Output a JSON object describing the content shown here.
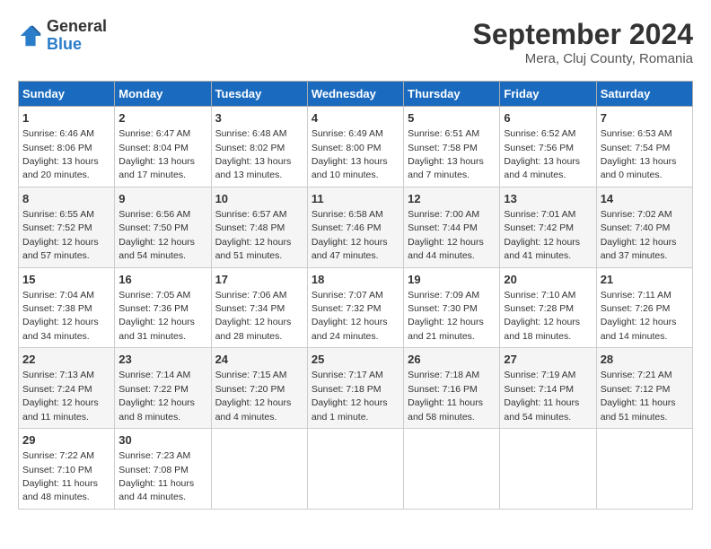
{
  "logo": {
    "line1": "General",
    "line2": "Blue"
  },
  "title": "September 2024",
  "subtitle": "Mera, Cluj County, Romania",
  "headers": [
    "Sunday",
    "Monday",
    "Tuesday",
    "Wednesday",
    "Thursday",
    "Friday",
    "Saturday"
  ],
  "weeks": [
    [
      {
        "day": "1",
        "info": "Sunrise: 6:46 AM\nSunset: 8:06 PM\nDaylight: 13 hours and 20 minutes."
      },
      {
        "day": "2",
        "info": "Sunrise: 6:47 AM\nSunset: 8:04 PM\nDaylight: 13 hours and 17 minutes."
      },
      {
        "day": "3",
        "info": "Sunrise: 6:48 AM\nSunset: 8:02 PM\nDaylight: 13 hours and 13 minutes."
      },
      {
        "day": "4",
        "info": "Sunrise: 6:49 AM\nSunset: 8:00 PM\nDaylight: 13 hours and 10 minutes."
      },
      {
        "day": "5",
        "info": "Sunrise: 6:51 AM\nSunset: 7:58 PM\nDaylight: 13 hours and 7 minutes."
      },
      {
        "day": "6",
        "info": "Sunrise: 6:52 AM\nSunset: 7:56 PM\nDaylight: 13 hours and 4 minutes."
      },
      {
        "day": "7",
        "info": "Sunrise: 6:53 AM\nSunset: 7:54 PM\nDaylight: 13 hours and 0 minutes."
      }
    ],
    [
      {
        "day": "8",
        "info": "Sunrise: 6:55 AM\nSunset: 7:52 PM\nDaylight: 12 hours and 57 minutes."
      },
      {
        "day": "9",
        "info": "Sunrise: 6:56 AM\nSunset: 7:50 PM\nDaylight: 12 hours and 54 minutes."
      },
      {
        "day": "10",
        "info": "Sunrise: 6:57 AM\nSunset: 7:48 PM\nDaylight: 12 hours and 51 minutes."
      },
      {
        "day": "11",
        "info": "Sunrise: 6:58 AM\nSunset: 7:46 PM\nDaylight: 12 hours and 47 minutes."
      },
      {
        "day": "12",
        "info": "Sunrise: 7:00 AM\nSunset: 7:44 PM\nDaylight: 12 hours and 44 minutes."
      },
      {
        "day": "13",
        "info": "Sunrise: 7:01 AM\nSunset: 7:42 PM\nDaylight: 12 hours and 41 minutes."
      },
      {
        "day": "14",
        "info": "Sunrise: 7:02 AM\nSunset: 7:40 PM\nDaylight: 12 hours and 37 minutes."
      }
    ],
    [
      {
        "day": "15",
        "info": "Sunrise: 7:04 AM\nSunset: 7:38 PM\nDaylight: 12 hours and 34 minutes."
      },
      {
        "day": "16",
        "info": "Sunrise: 7:05 AM\nSunset: 7:36 PM\nDaylight: 12 hours and 31 minutes."
      },
      {
        "day": "17",
        "info": "Sunrise: 7:06 AM\nSunset: 7:34 PM\nDaylight: 12 hours and 28 minutes."
      },
      {
        "day": "18",
        "info": "Sunrise: 7:07 AM\nSunset: 7:32 PM\nDaylight: 12 hours and 24 minutes."
      },
      {
        "day": "19",
        "info": "Sunrise: 7:09 AM\nSunset: 7:30 PM\nDaylight: 12 hours and 21 minutes."
      },
      {
        "day": "20",
        "info": "Sunrise: 7:10 AM\nSunset: 7:28 PM\nDaylight: 12 hours and 18 minutes."
      },
      {
        "day": "21",
        "info": "Sunrise: 7:11 AM\nSunset: 7:26 PM\nDaylight: 12 hours and 14 minutes."
      }
    ],
    [
      {
        "day": "22",
        "info": "Sunrise: 7:13 AM\nSunset: 7:24 PM\nDaylight: 12 hours and 11 minutes."
      },
      {
        "day": "23",
        "info": "Sunrise: 7:14 AM\nSunset: 7:22 PM\nDaylight: 12 hours and 8 minutes."
      },
      {
        "day": "24",
        "info": "Sunrise: 7:15 AM\nSunset: 7:20 PM\nDaylight: 12 hours and 4 minutes."
      },
      {
        "day": "25",
        "info": "Sunrise: 7:17 AM\nSunset: 7:18 PM\nDaylight: 12 hours and 1 minute."
      },
      {
        "day": "26",
        "info": "Sunrise: 7:18 AM\nSunset: 7:16 PM\nDaylight: 11 hours and 58 minutes."
      },
      {
        "day": "27",
        "info": "Sunrise: 7:19 AM\nSunset: 7:14 PM\nDaylight: 11 hours and 54 minutes."
      },
      {
        "day": "28",
        "info": "Sunrise: 7:21 AM\nSunset: 7:12 PM\nDaylight: 11 hours and 51 minutes."
      }
    ],
    [
      {
        "day": "29",
        "info": "Sunrise: 7:22 AM\nSunset: 7:10 PM\nDaylight: 11 hours and 48 minutes."
      },
      {
        "day": "30",
        "info": "Sunrise: 7:23 AM\nSunset: 7:08 PM\nDaylight: 11 hours and 44 minutes."
      },
      {
        "day": "",
        "info": ""
      },
      {
        "day": "",
        "info": ""
      },
      {
        "day": "",
        "info": ""
      },
      {
        "day": "",
        "info": ""
      },
      {
        "day": "",
        "info": ""
      }
    ]
  ]
}
